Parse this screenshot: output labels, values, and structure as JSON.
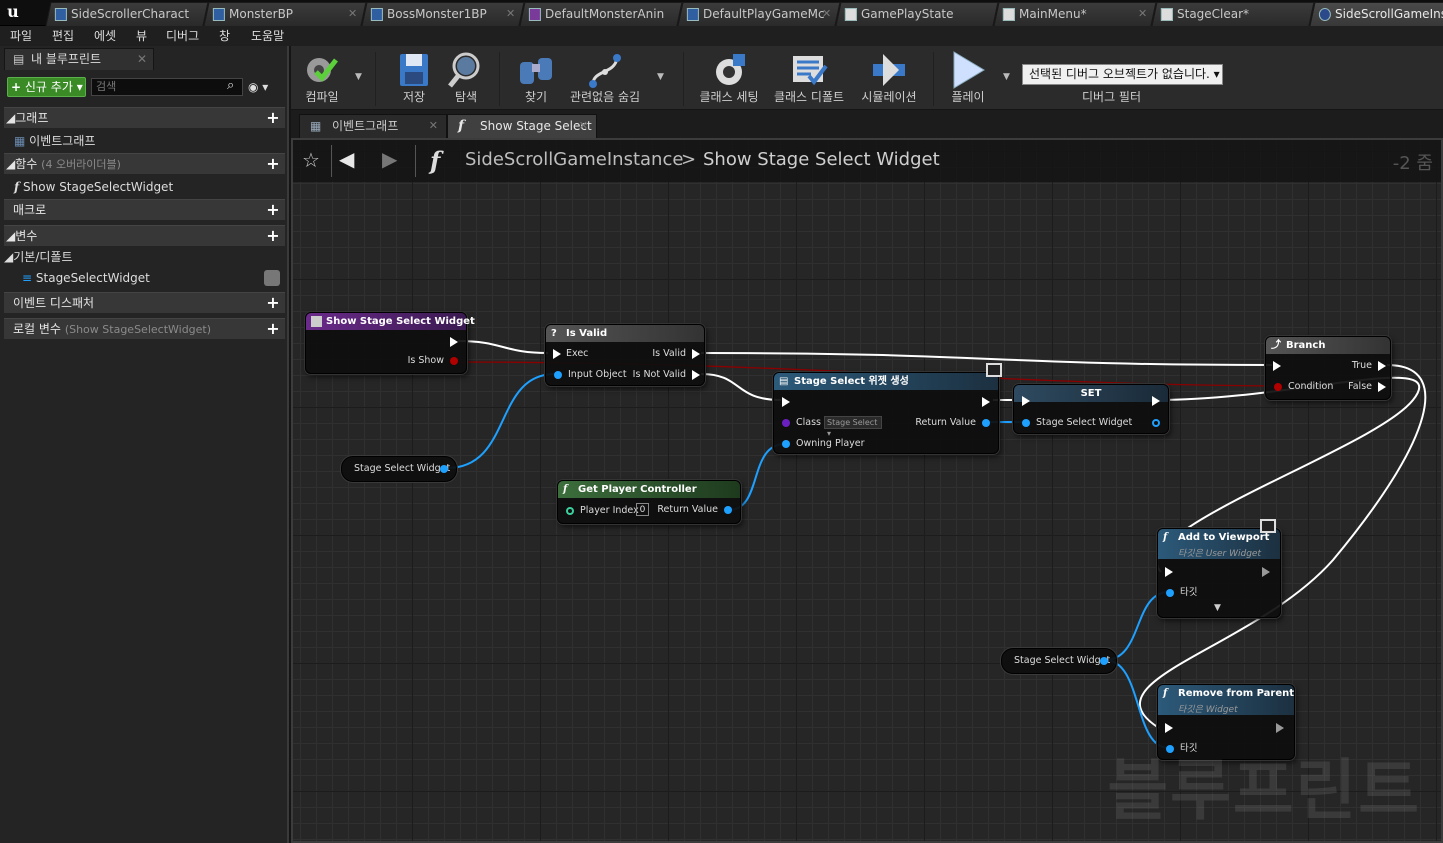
{
  "tabs": [
    {
      "label": "SideScrollerCharact"
    },
    {
      "label": "MonsterBP"
    },
    {
      "label": "BossMonster1BP"
    },
    {
      "label": "DefaultMonsterAnin"
    },
    {
      "label": "DefaultPlayGameMc"
    },
    {
      "label": "GamePlayState"
    },
    {
      "label": "MainMenu*"
    },
    {
      "label": "StageClear*"
    },
    {
      "label": "SideScrollGameIns*"
    }
  ],
  "menu": [
    "파일",
    "편집",
    "에셋",
    "뷰",
    "디버그",
    "창",
    "도움말"
  ],
  "my_blueprint": {
    "tab_label": "내 블루프린트",
    "add_new_label": "신규 추가",
    "search_placeholder": "검색",
    "sections": {
      "graph": "그래프",
      "event_graph": "이벤트그래프",
      "functions": "함수",
      "functions_sub": "(4 오버라이더블)",
      "function_item": "Show StageSelectWidget",
      "macros": "매크로",
      "variables": "변수",
      "default_category": "기본/디폴트",
      "variable_item": "StageSelectWidget",
      "event_dispatchers": "이벤트 디스패처",
      "local_vars": "로컬 변수",
      "local_vars_sub": "(Show StageSelectWidget)"
    }
  },
  "toolbar": {
    "compile": "컴파일",
    "save": "저장",
    "browse": "탐색",
    "find": "찾기",
    "hide_unrelated": "관련없음 숨김",
    "class_settings": "클래스 세팅",
    "class_defaults": "클래스 디폴트",
    "simulation": "시뮬레이션",
    "play": "플레이",
    "debug_select": "선택된 디버그 오브젝트가 없습니다.",
    "debug_filter": "디버그 필터"
  },
  "graph_tabs": {
    "event_graph": "이벤트그래프",
    "show_stage_select": "Show Stage Select"
  },
  "graph_header": {
    "breadcrumb_1": "SideScrollGameInstance",
    "breadcrumb_sep": ">",
    "breadcrumb_2": "Show Stage Select Widget",
    "zoom": "-2 줌"
  },
  "watermark": "블루프린트",
  "nodes": {
    "entry": {
      "title": "Show Stage Select Widget",
      "pin_is_show": "Is Show"
    },
    "is_valid": {
      "title": "Is Valid",
      "pin_exec": "Exec",
      "pin_input": "Input Object",
      "pin_valid": "Is Valid",
      "pin_not_valid": "Is Not Valid"
    },
    "var_get_1": {
      "label": "Stage Select Widget"
    },
    "create_widget": {
      "title": "Stage Select 위젯 생성",
      "pin_class": "Class",
      "class_value": "Stage Select",
      "pin_owning": "Owning Player",
      "pin_return": "Return Value"
    },
    "get_pc": {
      "title": "Get Player Controller",
      "pin_index": "Player Index",
      "index_value": "0",
      "pin_return": "Return Value"
    },
    "set_var": {
      "title": "SET",
      "pin_value": "Stage Select Widget"
    },
    "branch": {
      "title": "Branch",
      "pin_condition": "Condition",
      "pin_true": "True",
      "pin_false": "False"
    },
    "add_to_viewport": {
      "title": "Add to Viewport",
      "subtitle": "타깃은 User Widget",
      "pin_target": "타깃"
    },
    "var_get_2": {
      "label": "Stage Select Widget"
    },
    "remove_from_parent": {
      "title": "Remove from Parent",
      "subtitle": "타깃은 Widget",
      "pin_target": "타깃"
    }
  },
  "colors": {
    "function_entry_title": "#5a2a7a",
    "pure_function_title": "#3a6a3a",
    "set_title": "#3a4a5a",
    "object_pin": "#1ea0ff",
    "bool_pin": "#a00000",
    "class_pin": "#6a20c0",
    "add_new_button": "#3a8a26"
  }
}
